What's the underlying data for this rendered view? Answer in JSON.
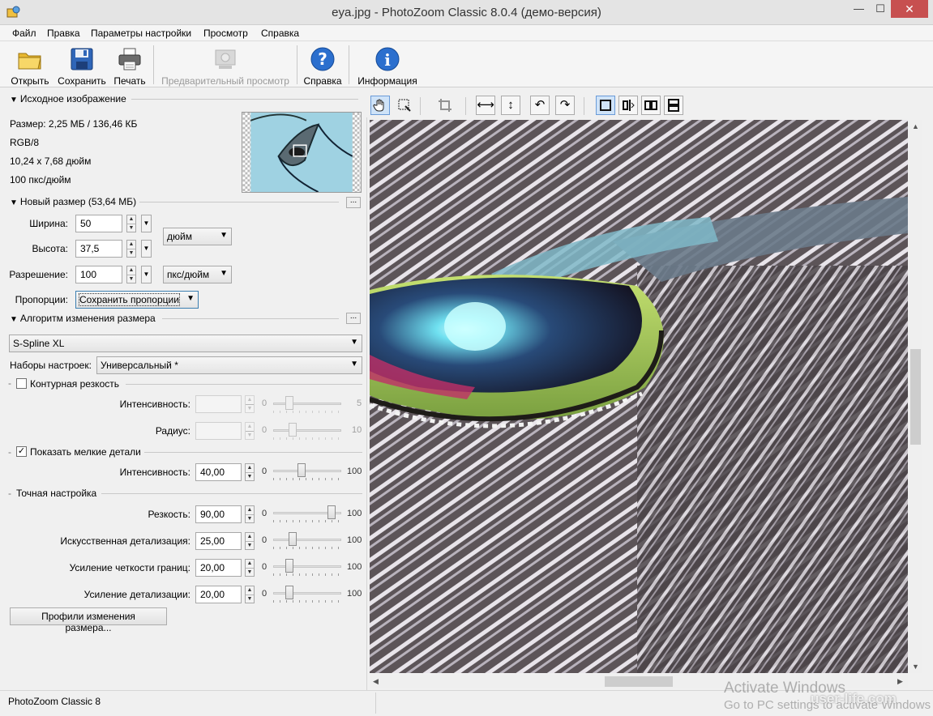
{
  "window": {
    "title": "eya.jpg - PhotoZoom Classic 8.0.4 (демо-версия)",
    "minimize": "—",
    "maximize": "☐",
    "close": "✕"
  },
  "menu": [
    "Файл",
    "Правка",
    "Параметры настройки",
    "Просмотр",
    "Справка"
  ],
  "toolbar": {
    "open": "Открыть",
    "save": "Сохранить",
    "print": "Печать",
    "preview": "Предварительный просмотр",
    "help": "Справка",
    "info": "Информация"
  },
  "source": {
    "heading": "Исходное изображение",
    "size": "Размер: 2,25 МБ / 136,46 КБ",
    "mode": "RGB/8",
    "dimensions": "10,24 x 7,68 дюйм",
    "resolution": "100 пкс/дюйм"
  },
  "new_size": {
    "heading": "Новый размер (53,64 МБ)",
    "dots": "...",
    "width_label": "Ширина:",
    "width_value": "50",
    "height_label": "Высота:",
    "height_value": "37,5",
    "unit": "дюйм",
    "resolution_label": "Разрешение:",
    "resolution_value": "100",
    "resolution_unit": "пкс/дюйм",
    "proportions_label": "Пропорции:",
    "proportions_value": "Сохранить пропорции"
  },
  "algorithm": {
    "heading": "Алгоритм изменения размера",
    "dots": "...",
    "method": "S-Spline XL",
    "presets_label": "Наборы настроек:",
    "presets_value": "Универсальный *"
  },
  "unsharp": {
    "label": "Контурная резкость",
    "checked": false,
    "intensity_label": "Интенсивность:",
    "intensity_value": "",
    "intensity_min": "0",
    "intensity_max": "5",
    "intensity_level": 0.2,
    "radius_label": "Радиус:",
    "radius_value": "",
    "radius_min": "0",
    "radius_max": "10",
    "radius_level": 0.25
  },
  "fine_details": {
    "label": "Показать мелкие детали",
    "checked": true,
    "check_mark": "✓",
    "intensity_label": "Интенсивность:",
    "intensity_value": "40,00",
    "min": "0",
    "max": "100",
    "level": 0.4
  },
  "fine_tuning": {
    "heading": "Точная настройка",
    "rows": [
      {
        "label": "Резкость:",
        "value": "90,00",
        "min": "0",
        "max": "100",
        "level": 0.9
      },
      {
        "label": "Искусственная детализация:",
        "value": "25,00",
        "min": "0",
        "max": "100",
        "level": 0.25
      },
      {
        "label": "Усиление четкости границ:",
        "value": "20,00",
        "min": "0",
        "max": "100",
        "level": 0.2
      },
      {
        "label": "Усиление детализации:",
        "value": "20,00",
        "min": "0",
        "max": "100",
        "level": 0.2
      }
    ],
    "profiles_button": "Профили изменения размера..."
  },
  "view_tools": [
    "hand-icon",
    "select-icon",
    "crop-icon",
    "flip-horizontal-icon",
    "flip-vertical-icon",
    "rotate-left-icon",
    "rotate-right-icon",
    "single-view-icon",
    "split-vertical-icon",
    "side-by-side-icon",
    "split-horizontal-icon"
  ],
  "status": {
    "text": "PhotoZoom Classic 8"
  },
  "watermark": {
    "line1": "Activate Windows",
    "line2": "Go to PC settings to activate Windows",
    "site": "user-life.com"
  },
  "colors": {
    "accent": "#6a9bd8",
    "close_button": "#c75050",
    "help_blue": "#2b6fce"
  }
}
